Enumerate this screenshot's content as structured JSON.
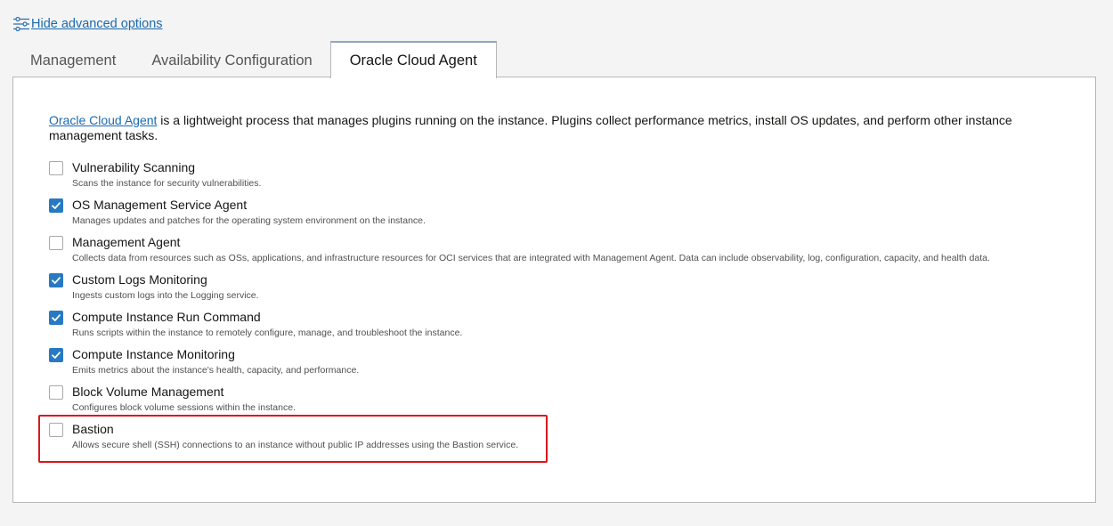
{
  "advanced_link": {
    "label": "Hide advanced options",
    "icon": "sliders-icon"
  },
  "tabs": [
    {
      "label": "Management",
      "active": false
    },
    {
      "label": "Availability Configuration",
      "active": false
    },
    {
      "label": "Oracle Cloud Agent",
      "active": true
    }
  ],
  "intro": {
    "link_text": "Oracle Cloud Agent",
    "text": " is a lightweight process that manages plugins running on the instance. Plugins collect performance metrics, install OS updates, and perform other instance management tasks."
  },
  "options": [
    {
      "label": "Vulnerability Scanning",
      "description": "Scans the instance for security vulnerabilities.",
      "checked": false
    },
    {
      "label": "OS Management Service Agent",
      "description": "Manages updates and patches for the operating system environment on the instance.",
      "checked": true
    },
    {
      "label": "Management Agent",
      "description": "Collects data from resources such as OSs, applications, and infrastructure resources for OCI services that are integrated with Management Agent. Data can include observability, log, configuration, capacity, and health data.",
      "checked": false
    },
    {
      "label": "Custom Logs Monitoring",
      "description": "Ingests custom logs into the Logging service.",
      "checked": true
    },
    {
      "label": "Compute Instance Run Command",
      "description": "Runs scripts within the instance to remotely configure, manage, and troubleshoot the instance.",
      "checked": true
    },
    {
      "label": "Compute Instance Monitoring",
      "description": "Emits metrics about the instance's health, capacity, and performance.",
      "checked": true
    },
    {
      "label": "Block Volume Management",
      "description": "Configures block volume sessions within the instance.",
      "checked": false
    },
    {
      "label": "Bastion",
      "description": "Allows secure shell (SSH) connections to an instance without public IP addresses using the Bastion service.",
      "checked": false
    }
  ],
  "colors": {
    "link": "#1b6ab0",
    "checkbox_checked": "#2779c2",
    "highlight": "#d9181e"
  }
}
